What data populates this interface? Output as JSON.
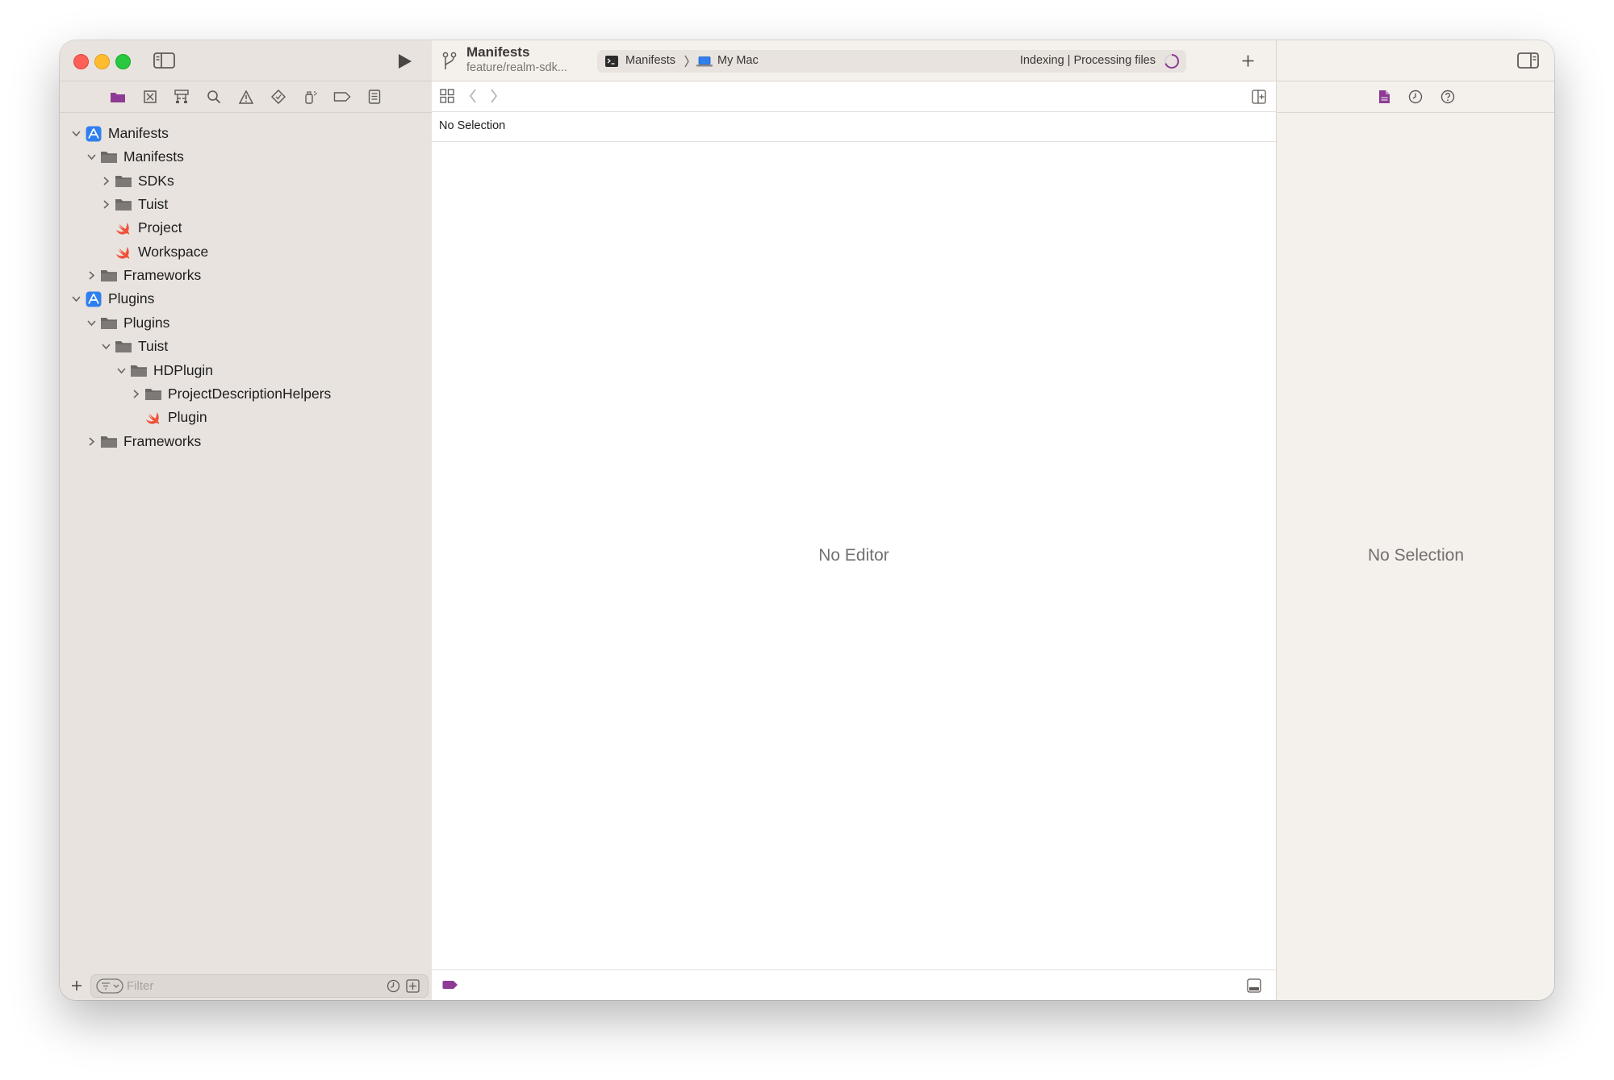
{
  "window": {
    "scheme": "Manifests",
    "branch": "feature/realm-sdk...",
    "activity": {
      "target": "Manifests",
      "destination": "My Mac",
      "status": "Indexing | Processing files"
    }
  },
  "navigator": {
    "tabs": [
      "project-navigator",
      "source-control-navigator",
      "symbol-navigator",
      "find-navigator",
      "issue-navigator",
      "test-navigator",
      "debug-navigator",
      "breakpoint-navigator",
      "report-navigator"
    ],
    "tree": [
      {
        "label": "Manifests",
        "icon": "project-icon",
        "depth": 0,
        "disclosure": "expanded"
      },
      {
        "label": "Manifests",
        "icon": "folder-icon",
        "depth": 1,
        "disclosure": "expanded"
      },
      {
        "label": "SDKs",
        "icon": "folder-icon",
        "depth": 2,
        "disclosure": "collapsed"
      },
      {
        "label": "Tuist",
        "icon": "folder-icon",
        "depth": 2,
        "disclosure": "collapsed"
      },
      {
        "label": "Project",
        "icon": "swift-file-icon",
        "depth": 2,
        "disclosure": "none"
      },
      {
        "label": "Workspace",
        "icon": "swift-file-icon",
        "depth": 2,
        "disclosure": "none"
      },
      {
        "label": "Frameworks",
        "icon": "folder-icon",
        "depth": 1,
        "disclosure": "collapsed"
      },
      {
        "label": "Plugins",
        "icon": "project-icon",
        "depth": 0,
        "disclosure": "expanded"
      },
      {
        "label": "Plugins",
        "icon": "folder-icon",
        "depth": 1,
        "disclosure": "expanded"
      },
      {
        "label": "Tuist",
        "icon": "folder-icon",
        "depth": 2,
        "disclosure": "expanded"
      },
      {
        "label": "HDPlugin",
        "icon": "folder-icon",
        "depth": 3,
        "disclosure": "expanded"
      },
      {
        "label": "ProjectDescriptionHelpers",
        "icon": "folder-icon",
        "depth": 4,
        "disclosure": "collapsed"
      },
      {
        "label": "Plugin",
        "icon": "swift-file-icon",
        "depth": 4,
        "disclosure": "none"
      },
      {
        "label": "Frameworks",
        "icon": "folder-icon",
        "depth": 1,
        "disclosure": "collapsed"
      }
    ],
    "filter_placeholder": "Filter"
  },
  "editor": {
    "path_label": "No Selection",
    "message": "No Editor"
  },
  "inspector": {
    "tabs": [
      "file-inspector",
      "history-inspector",
      "quick-help-inspector"
    ],
    "message": "No Selection"
  },
  "colors": {
    "accent": "#8e3b96",
    "swift": "#f05138",
    "folder": "#6b6764",
    "project_blue": "#2f7ff0"
  }
}
